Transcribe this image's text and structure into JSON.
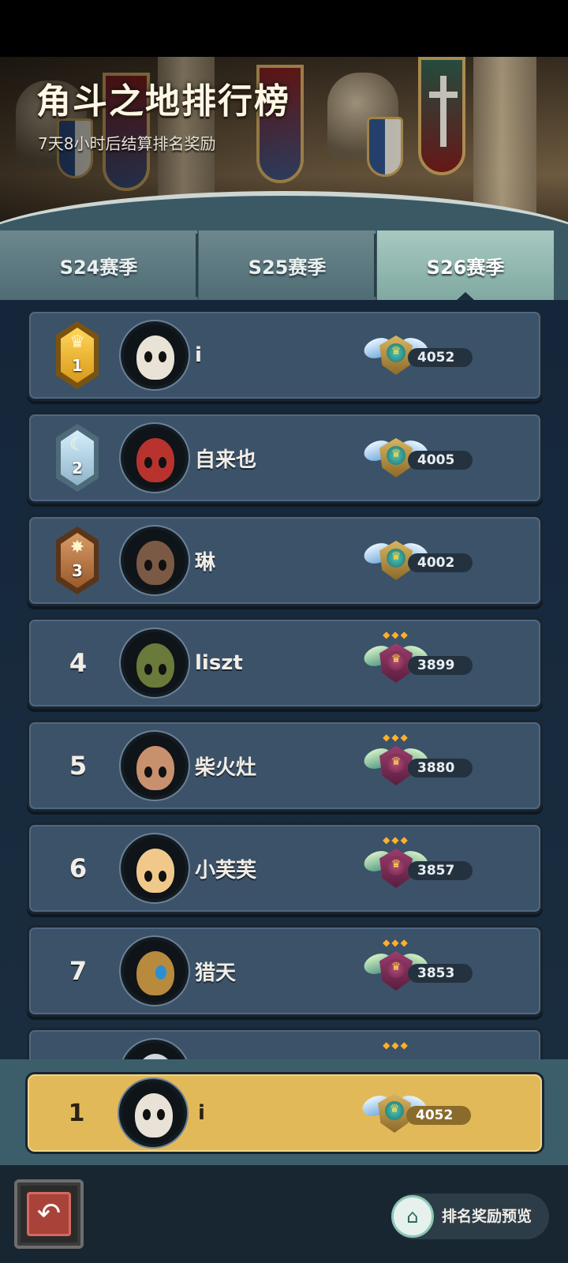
{
  "header": {
    "title": "角斗之地排行榜",
    "countdown": "7天8小时后结算排名奖励"
  },
  "tabs": [
    {
      "label": "S24赛季",
      "selected": false
    },
    {
      "label": "S25赛季",
      "selected": false
    },
    {
      "label": "S26赛季",
      "selected": true
    }
  ],
  "leaderboard": [
    {
      "rank": "1",
      "name": "i",
      "score": "4052",
      "badge": "gold"
    },
    {
      "rank": "2",
      "name": "自来也",
      "score": "4005",
      "badge": "silver"
    },
    {
      "rank": "3",
      "name": "琳",
      "score": "4002",
      "badge": "bronze"
    },
    {
      "rank": "4",
      "name": "liszt",
      "score": "3899"
    },
    {
      "rank": "5",
      "name": "柴火灶",
      "score": "3880"
    },
    {
      "rank": "6",
      "name": "小芙芙",
      "score": "3857"
    },
    {
      "rank": "7",
      "name": "猎天",
      "score": "3853"
    }
  ],
  "self_entry": {
    "rank": "1",
    "name": "i",
    "score": "4052"
  },
  "footer": {
    "back_icon": "back-arrow-icon",
    "reward_preview_label": "排名奖励预览",
    "reward_icon": "reward-chest-icon"
  },
  "colors": {
    "row_bg": "#3b5269",
    "self_row_bg": "#e2b959",
    "selected_tab": "#80a9a1"
  }
}
